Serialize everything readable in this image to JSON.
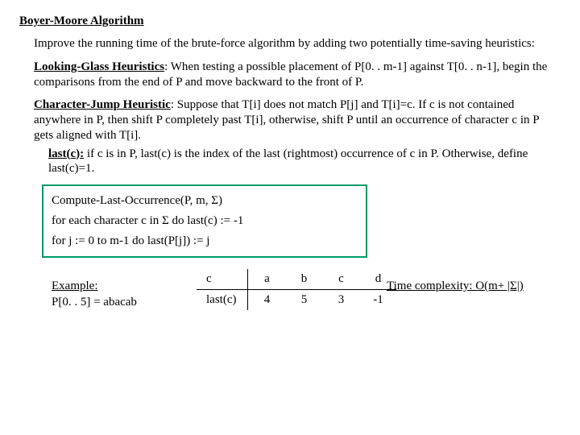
{
  "title": "Boyer-Moore Algorithm",
  "intro": "Improve the running time of the brute-force algorithm by adding two potentially time-saving heuristics:",
  "lg": {
    "name": "Looking-Glass Heuristics",
    "text": ": When testing a possible placement of P[0. . m-1] against T[0. . n-1], begin the comparisons from the end of P and move backward to the front of P."
  },
  "cj": {
    "name": "Character-Jump Heuristic",
    "text": ": Suppose that T[i] does not match P[j] and T[i]=c. If c is not contained anywhere in P, then shift P completely past T[i], otherwise, shift P until an occurrence of character c in P gets aligned with T[i]."
  },
  "lastc": {
    "name": "last(c):",
    "text": " if c is in P, last(c) is the index of the last (rightmost) occurrence of c in P. Otherwise, define last(c)=1."
  },
  "algo": {
    "header": "Compute-Last-Occurrence(P, m, Σ)",
    "line1": "for each character c in Σ do last(c) := -1",
    "line2": "for j := 0 to m-1 do last(P[j]) := j"
  },
  "complexity": "Time complexity: O(m+ |Σ|)",
  "example": {
    "label1": "Example:",
    "label2": "P[0. . 5] = abacab",
    "rowhead": "c",
    "row2head": "last(c)",
    "cols": [
      "a",
      "b",
      "c",
      "d"
    ],
    "vals": [
      "4",
      "5",
      "3",
      "-1"
    ]
  }
}
